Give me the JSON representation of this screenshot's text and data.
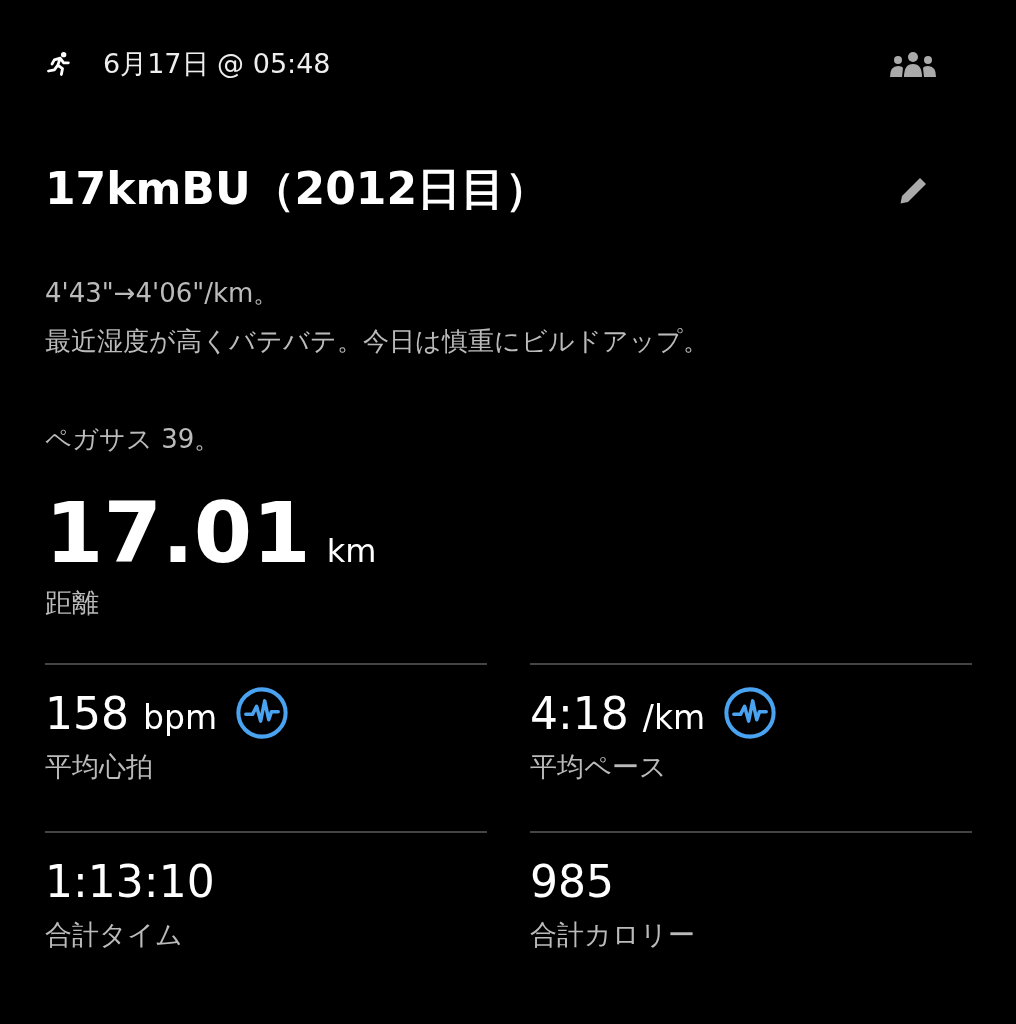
{
  "header": {
    "datetime": "6月17日 @ 05:48"
  },
  "title": "17kmBU（2012日目）",
  "description": [
    [
      "4'43\"→4'06\"/km。",
      "最近湿度が高くバテバテ。今日は慎重にビルドアップ。"
    ],
    [
      "ペガサス 39。"
    ]
  ],
  "distance": {
    "value": "17.01",
    "unit": "km",
    "label": "距離"
  },
  "stats": [
    {
      "value": "158",
      "unit": "bpm",
      "label": "平均心拍",
      "chart_icon": true
    },
    {
      "value": "4:18",
      "unit": "/km",
      "label": "平均ペース",
      "chart_icon": true
    },
    {
      "value": "1:13:10",
      "label": "合計タイム",
      "chart_icon": false
    },
    {
      "value": "985",
      "label": "合計カロリー",
      "chart_icon": false
    }
  ]
}
